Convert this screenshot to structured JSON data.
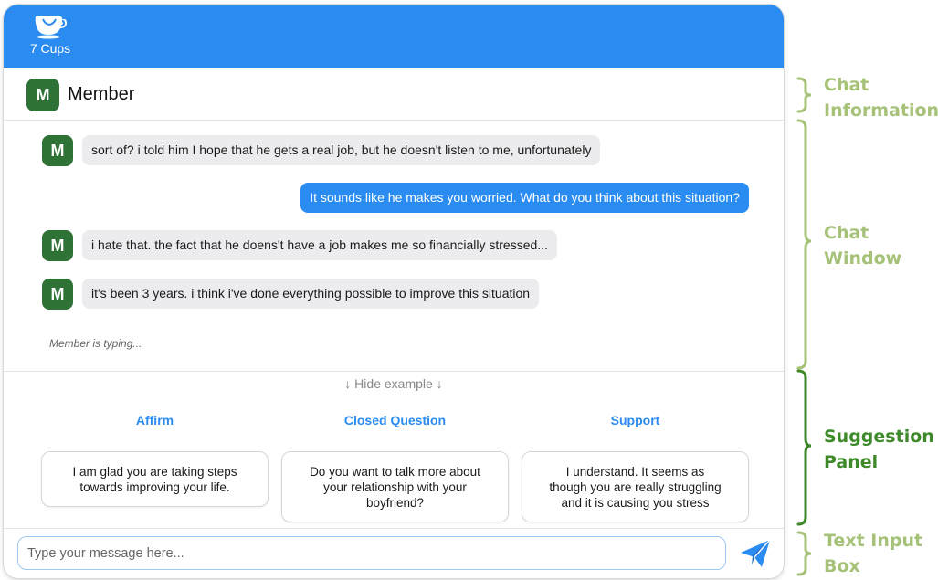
{
  "app": {
    "name": "7 Cups"
  },
  "chat_info": {
    "avatar_letter": "M",
    "name": "Member"
  },
  "messages": [
    {
      "sender": "member",
      "avatar": "M",
      "text": "sort of? i told him I hope that he gets a real job, but he doesn't listen to me, unfortunately"
    },
    {
      "sender": "listener",
      "avatar": "",
      "text": "It sounds like he makes you worried. What do you think about this situation?"
    },
    {
      "sender": "member",
      "avatar": "M",
      "text": "i hate that. the fact that he doens't have a job makes me so financially stressed..."
    },
    {
      "sender": "member",
      "avatar": "M",
      "text": "it's been 3 years. i think i've done everything possible to improve this situation"
    }
  ],
  "typing_indicator": "Member is typing...",
  "suggestion_panel": {
    "toggle_label": "↓ Hide example ↓",
    "suggestions": [
      {
        "category": "Affirm",
        "lines": [
          "I am glad you are taking steps",
          "towards improving your life."
        ]
      },
      {
        "category": "Closed Question",
        "lines": [
          "Do you want to talk more about",
          "your relationship with your",
          "boyfriend?"
        ]
      },
      {
        "category": "Support",
        "lines": [
          "I understand. It seems as",
          "though you are really struggling",
          "and it is causing you stress"
        ]
      }
    ]
  },
  "input": {
    "placeholder": "Type your message here...",
    "value": ""
  },
  "annotations": [
    {
      "line1": "Chat",
      "line2": "Information",
      "color": "#a5c278"
    },
    {
      "line1": "Chat",
      "line2": "Window",
      "color": "#a5c278"
    },
    {
      "line1": "Suggestion",
      "line2": "Panel",
      "color": "#3e8a2a"
    },
    {
      "line1": "Text Input",
      "line2": "Box",
      "color": "#a5c278"
    }
  ],
  "colors": {
    "primary": "#2a8cf1",
    "avatar": "#2e7236",
    "incoming_bubble": "#ececef"
  },
  "icons": {
    "logo": "teacup-icon",
    "send": "paper-plane-icon"
  }
}
